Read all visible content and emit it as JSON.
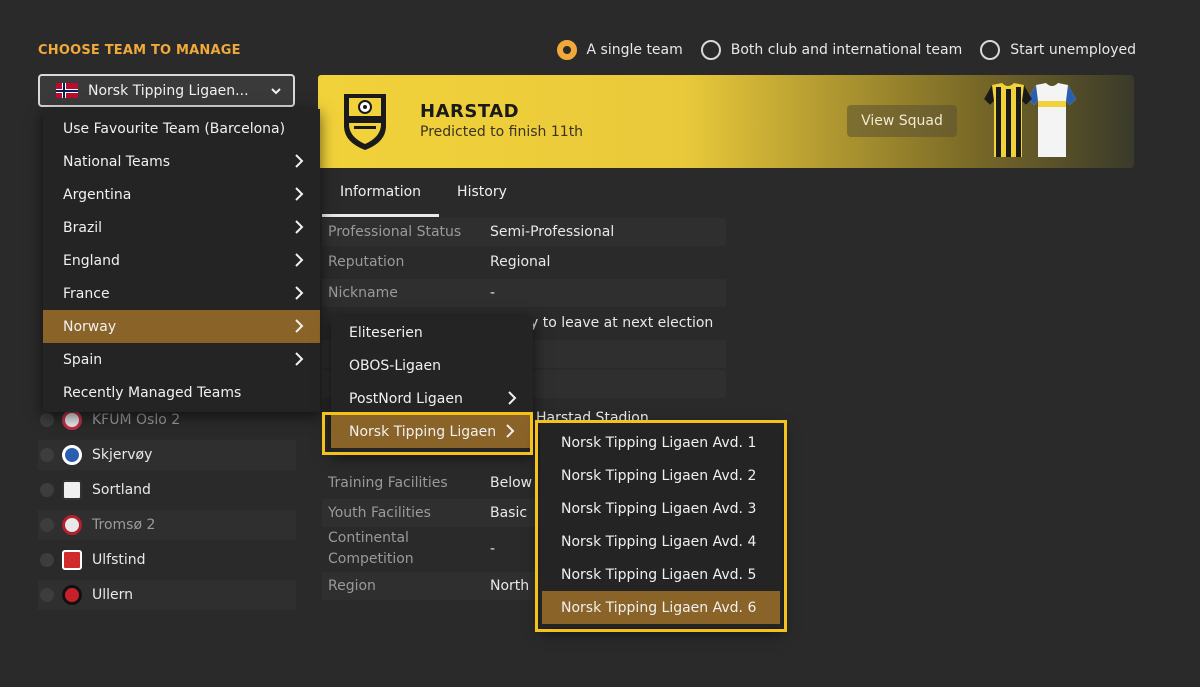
{
  "header": {
    "title": "CHOOSE TEAM TO MANAGE"
  },
  "mode_options": [
    {
      "label": "A single team",
      "selected": true
    },
    {
      "label": "Both club and international team",
      "selected": false
    },
    {
      "label": "Start unemployed",
      "selected": false
    }
  ],
  "team_select": {
    "value": "Norsk Tipping Ligaen...",
    "flag": "norway-flag-icon"
  },
  "club": {
    "name": "HARSTAD",
    "prediction": "Predicted to finish 11th",
    "view_squad_label": "View Squad",
    "colors": {
      "primary": "#f2d23a",
      "secondary": "#1a1a1a"
    }
  },
  "tabs": [
    {
      "label": "Information",
      "active": true
    },
    {
      "label": "History",
      "active": false
    }
  ],
  "info": [
    {
      "key": "Professional Status",
      "value": "Semi-Professional"
    },
    {
      "key": "Reputation",
      "value": "Regional"
    },
    {
      "key": "Nickname",
      "value": "-"
    },
    {
      "key": "",
      "value": "y to leave at next election"
    },
    {
      "key": "",
      "value": "Harstad Stadion"
    },
    {
      "key": "Training Facilities",
      "value": "Below"
    },
    {
      "key": "Youth Facilities",
      "value": "Basic"
    },
    {
      "key": "Continental\nCompetition",
      "value": "-"
    },
    {
      "key": "Region",
      "value": "North"
    }
  ],
  "club_list": [
    {
      "name": "KFUM Oslo 2"
    },
    {
      "name": "Skjervøy"
    },
    {
      "name": "Sortland"
    },
    {
      "name": "Tromsø 2"
    },
    {
      "name": "Ulfstind"
    },
    {
      "name": "Ullern"
    }
  ],
  "menu_level1": [
    {
      "label": "Use Favourite Team (Barcelona)",
      "submenu": false,
      "active": false
    },
    {
      "label": "National Teams",
      "submenu": true,
      "active": false
    },
    {
      "label": "Argentina",
      "submenu": true,
      "active": false
    },
    {
      "label": "Brazil",
      "submenu": true,
      "active": false
    },
    {
      "label": "England",
      "submenu": true,
      "active": false
    },
    {
      "label": "France",
      "submenu": true,
      "active": false
    },
    {
      "label": "Norway",
      "submenu": true,
      "active": true
    },
    {
      "label": "Spain",
      "submenu": true,
      "active": false
    },
    {
      "label": "Recently Managed Teams",
      "submenu": false,
      "active": false
    }
  ],
  "menu_level2": [
    {
      "label": "Eliteserien",
      "submenu": false,
      "active": false
    },
    {
      "label": "OBOS-Ligaen",
      "submenu": false,
      "active": false
    },
    {
      "label": "PostNord Ligaen",
      "submenu": true,
      "active": false
    },
    {
      "label": "Norsk Tipping Ligaen",
      "submenu": true,
      "active": true
    }
  ],
  "menu_level3": [
    {
      "label": "Norsk Tipping Ligaen Avd. 1",
      "active": false
    },
    {
      "label": "Norsk Tipping Ligaen Avd. 2",
      "active": false
    },
    {
      "label": "Norsk Tipping Ligaen Avd. 3",
      "active": false
    },
    {
      "label": "Norsk Tipping Ligaen Avd. 4",
      "active": false
    },
    {
      "label": "Norsk Tipping Ligaen Avd. 5",
      "active": false
    },
    {
      "label": "Norsk Tipping Ligaen Avd. 6",
      "active": true
    }
  ]
}
